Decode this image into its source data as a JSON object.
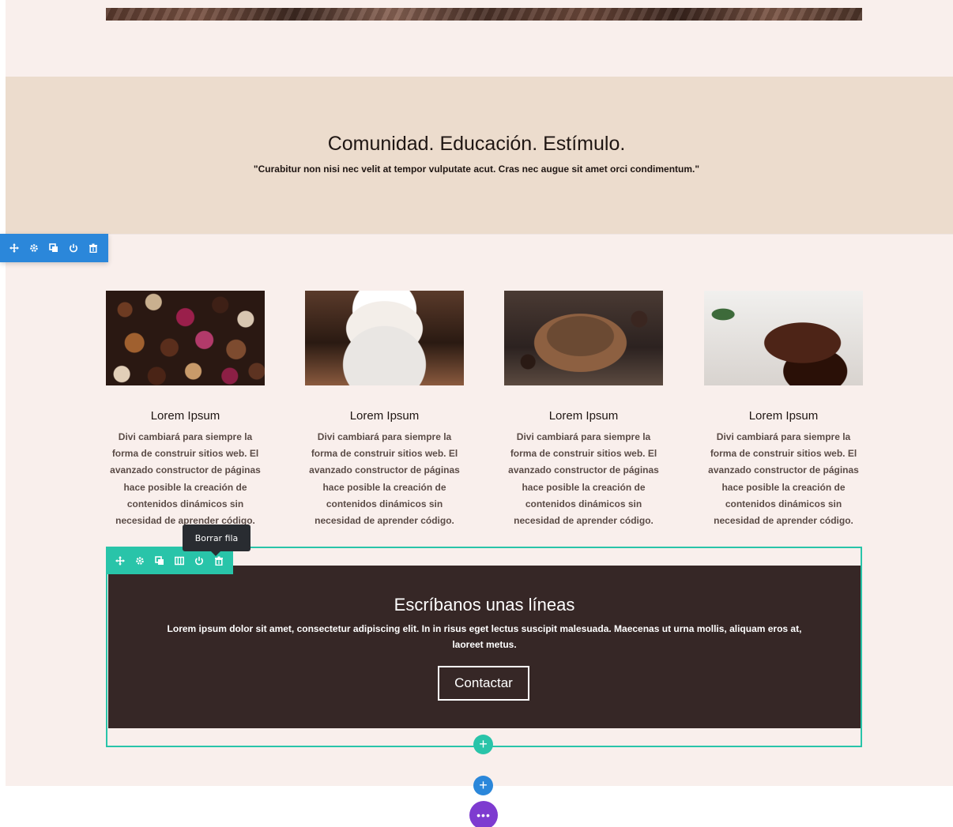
{
  "hero": {
    "title": "Comunidad. Educación. Estímulo.",
    "quote": "\"Curabitur non nisi nec velit at tempor vulputate acut. Cras nec augue sit amet orci condimentum.\""
  },
  "section_toolbar": {
    "icons": [
      "move-icon",
      "settings-gear-icon",
      "duplicate-icon",
      "power-icon",
      "trash-icon"
    ]
  },
  "cards": [
    {
      "title": "Lorem Ipsum",
      "text": "Divi cambiará para siempre la forma de construir sitios web. El avanzado constructor de páginas hace posible la creación de contenidos dinámicos sin necesidad de aprender código.",
      "image": "chocolates-image"
    },
    {
      "title": "Lorem Ipsum",
      "text": "Divi cambiará para siempre la forma de construir sitios web. El avanzado constructor de páginas hace posible la creación de contenidos dinámicos sin necesidad de aprender código.",
      "image": "hot-chocolate-cup-image"
    },
    {
      "title": "Lorem Ipsum",
      "text": "Divi cambiará para siempre la forma de construir sitios web. El avanzado constructor de páginas hace posible la creación de contenidos dinámicos sin necesidad de aprender código.",
      "image": "cocoa-powder-image"
    },
    {
      "title": "Lorem Ipsum",
      "text": "Divi cambiará para siempre la forma de construir sitios web. El avanzado constructor de páginas hace posible la creación de contenidos dinámicos sin necesidad de aprender código.",
      "image": "chocolate-cake-image"
    }
  ],
  "row_toolbar": {
    "icons": [
      "move-icon",
      "settings-gear-icon",
      "duplicate-icon",
      "columns-icon",
      "power-icon",
      "trash-icon"
    ],
    "tooltip": "Borrar fila"
  },
  "cta": {
    "title": "Escríbanos unas líneas",
    "text": "Lorem ipsum dolor sit amet, consectetur adipiscing elit. In in risus eget lectus suscipit malesuada. Maecenas ut urna mollis, aliquam eros at, laoreet metus.",
    "button_label": "Contactar"
  },
  "builder_controls": {
    "add_row_symbol": "+",
    "add_section_symbol": "+",
    "more_symbol": "•••"
  },
  "colors": {
    "page_bg": "#f9efec",
    "hero_band": "#ecdccd",
    "cta_bg": "#362726",
    "section_toolbar": "#2b87da",
    "row_toolbar": "#29c4a9",
    "more_button": "#7e3bd0"
  }
}
